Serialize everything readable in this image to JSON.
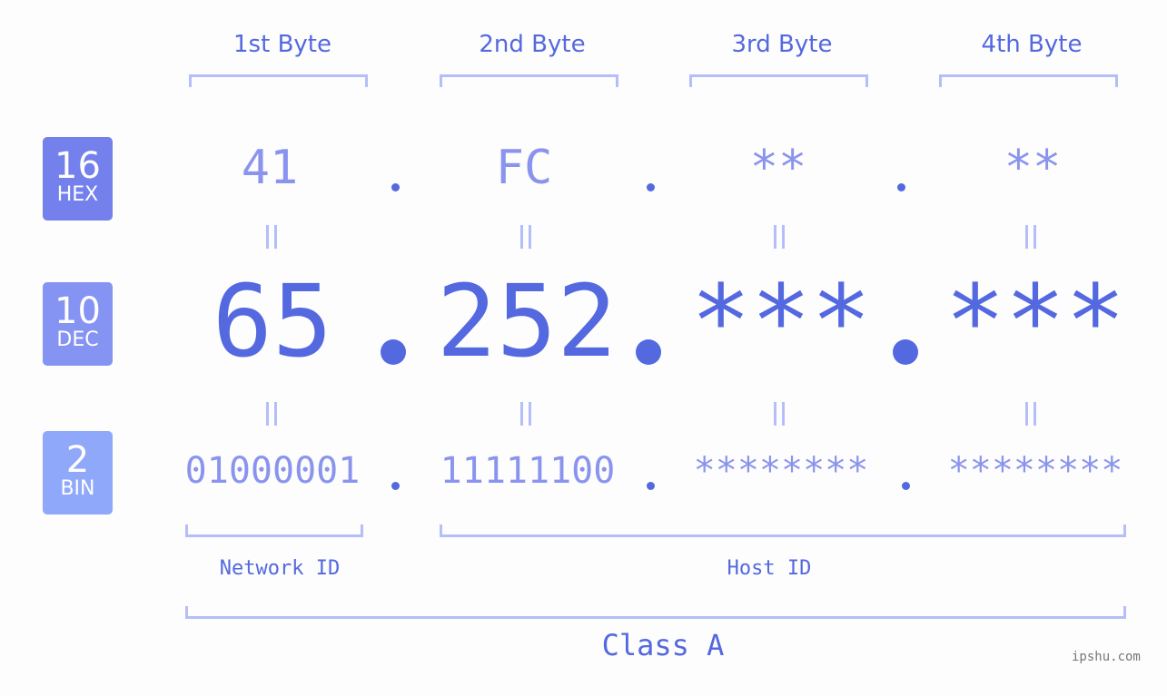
{
  "byte_headers": [
    "1st Byte",
    "2nd Byte",
    "3rd Byte",
    "4th Byte"
  ],
  "badges": {
    "hex": {
      "number": "16",
      "label": "HEX",
      "color": "#7480ec"
    },
    "dec": {
      "number": "10",
      "label": "DEC",
      "color": "#8593f3"
    },
    "bin": {
      "number": "2",
      "label": "BIN",
      "color": "#8fa8fa"
    }
  },
  "hex_values": [
    "41",
    "FC",
    "**",
    "**"
  ],
  "dec_values": [
    "65",
    "252",
    "***",
    "***"
  ],
  "bin_values": [
    "01000001",
    "11111100",
    "********",
    "********"
  ],
  "network_id_label": "Network ID",
  "host_id_label": "Host ID",
  "class_label": "Class A",
  "watermark": "ipshu.com",
  "colors": {
    "accent": "#5468e0",
    "light": "#8a94ee",
    "bracket": "#b5bef8"
  }
}
